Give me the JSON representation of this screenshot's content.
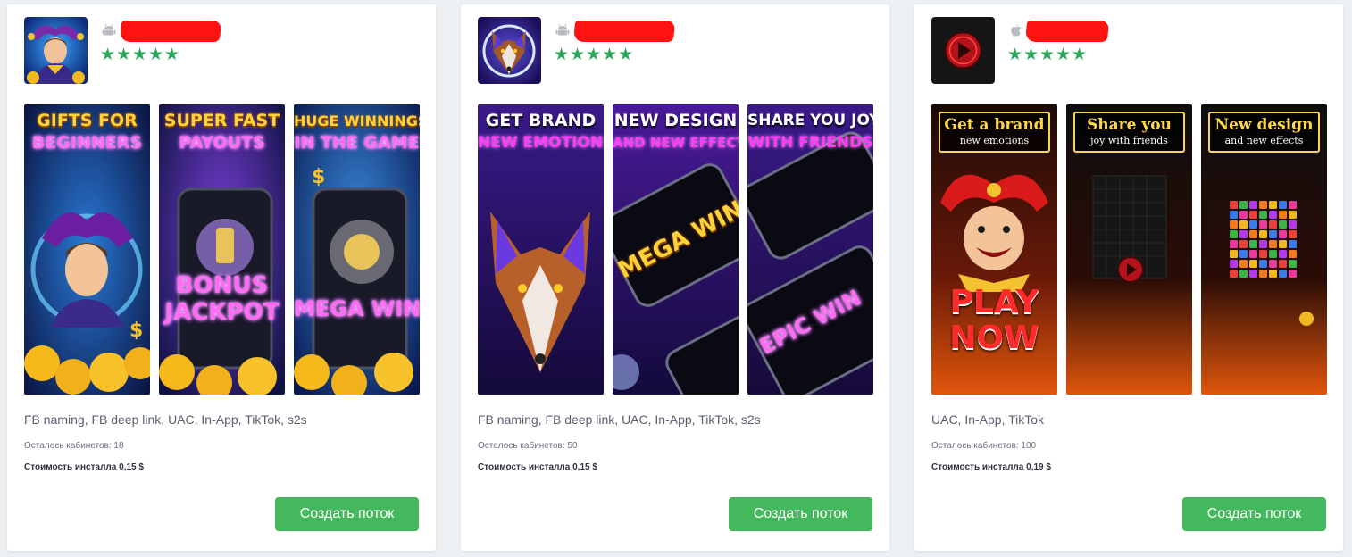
{
  "cards": [
    {
      "platform": "android-icon",
      "rating": 5,
      "screens": [
        {
          "line1": "GIFTS FOR",
          "line2": "BEGINNERS",
          "overlay": ""
        },
        {
          "line1": "SUPER FAST",
          "line2": "PAYOUTS",
          "overlay": "BONUS JACKPOT"
        },
        {
          "line1": "HUGE WINNINGS",
          "line2": "IN THE GAME",
          "overlay": "MEGA WIN"
        }
      ],
      "features": "FB naming, FB deep link, UAC, In-App, TikTok, s2s",
      "accounts_left": "Осталось кабинетов: 18",
      "install_cost": "Стоимость инсталла 0,15 $",
      "button_label": "Создать поток"
    },
    {
      "platform": "android-icon",
      "rating": 5,
      "screens": [
        {
          "line1": "GET BRAND",
          "line2": "NEW EMOTIONS",
          "overlay": ""
        },
        {
          "line1": "NEW DESIGN",
          "line2": "AND NEW EFFECTS",
          "overlay": "MEGA WIN"
        },
        {
          "line1": "SHARE YOU JOY",
          "line2": "WITH FRIENDS",
          "overlay": "EPIC WIN"
        }
      ],
      "features": "FB naming, FB deep link, UAC, In-App, TikTok, s2s",
      "accounts_left": "Осталось кабинетов: 50",
      "install_cost": "Стоимость инсталла 0,15 $",
      "button_label": "Создать поток"
    },
    {
      "platform": "apple-icon",
      "rating": 5,
      "screens": [
        {
          "line1": "Get a brand",
          "line2": "new emotions",
          "overlay": "PLAY NOW"
        },
        {
          "line1": "Share you",
          "line2": "joy with friends",
          "overlay": ""
        },
        {
          "line1": "New design",
          "line2": "and new effects",
          "overlay": ""
        }
      ],
      "features": "UAC, In-App, TikTok",
      "accounts_left": "Осталось кабинетов: 100",
      "install_cost": "Стоимость инсталла 0,19 $",
      "button_label": "Создать поток"
    }
  ],
  "colors": {
    "accent_green": "#44b85c",
    "star_green": "#2aa85a",
    "redaction": "#ff1212"
  }
}
